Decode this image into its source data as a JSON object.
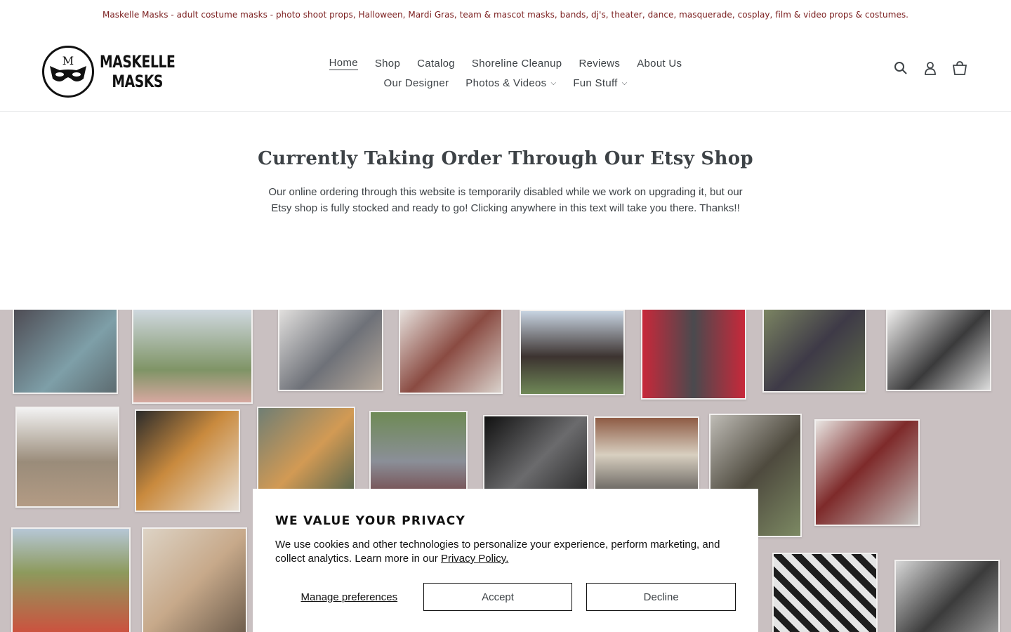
{
  "announcement": "Maskelle Masks - adult costume masks - photo shoot props, Halloween, Mardi Gras, team & mascot masks, bands, dj's, theater, dance, masquerade, cosplay, film & video props & costumes.",
  "logo": {
    "line1": "MASKELLE",
    "line2": "MASKS",
    "monogram": "M"
  },
  "nav": {
    "row1": [
      "Home",
      "Shop",
      "Catalog",
      "Shoreline Cleanup",
      "Reviews",
      "About Us"
    ],
    "row2": [
      "Our Designer",
      "Photos & Videos",
      "Fun Stuff"
    ]
  },
  "header_icons": [
    "search-icon",
    "account-icon",
    "cart-icon"
  ],
  "notice": {
    "title": "Currently Taking Order Through Our Etsy Shop",
    "body": "Our online ordering through this website is temporarily disabled while we work on upgrading it, but our Etsy shop is fully stocked and ready to go! Clicking anywhere in this text will take you there. Thanks!!"
  },
  "cookie_banner": {
    "title": "WE VALUE YOUR PRIVACY",
    "text": "We use cookies and other technologies to personalize your experience, perform marketing, and collect analytics. Learn more in our",
    "link": "Privacy Policy.",
    "manage": "Manage preferences",
    "accept": "Accept",
    "decline": "Decline"
  },
  "colors": {
    "announcement_text": "#7a1d1d",
    "body_text": "#3d4246",
    "collage_bg": "#c9c0c1"
  }
}
